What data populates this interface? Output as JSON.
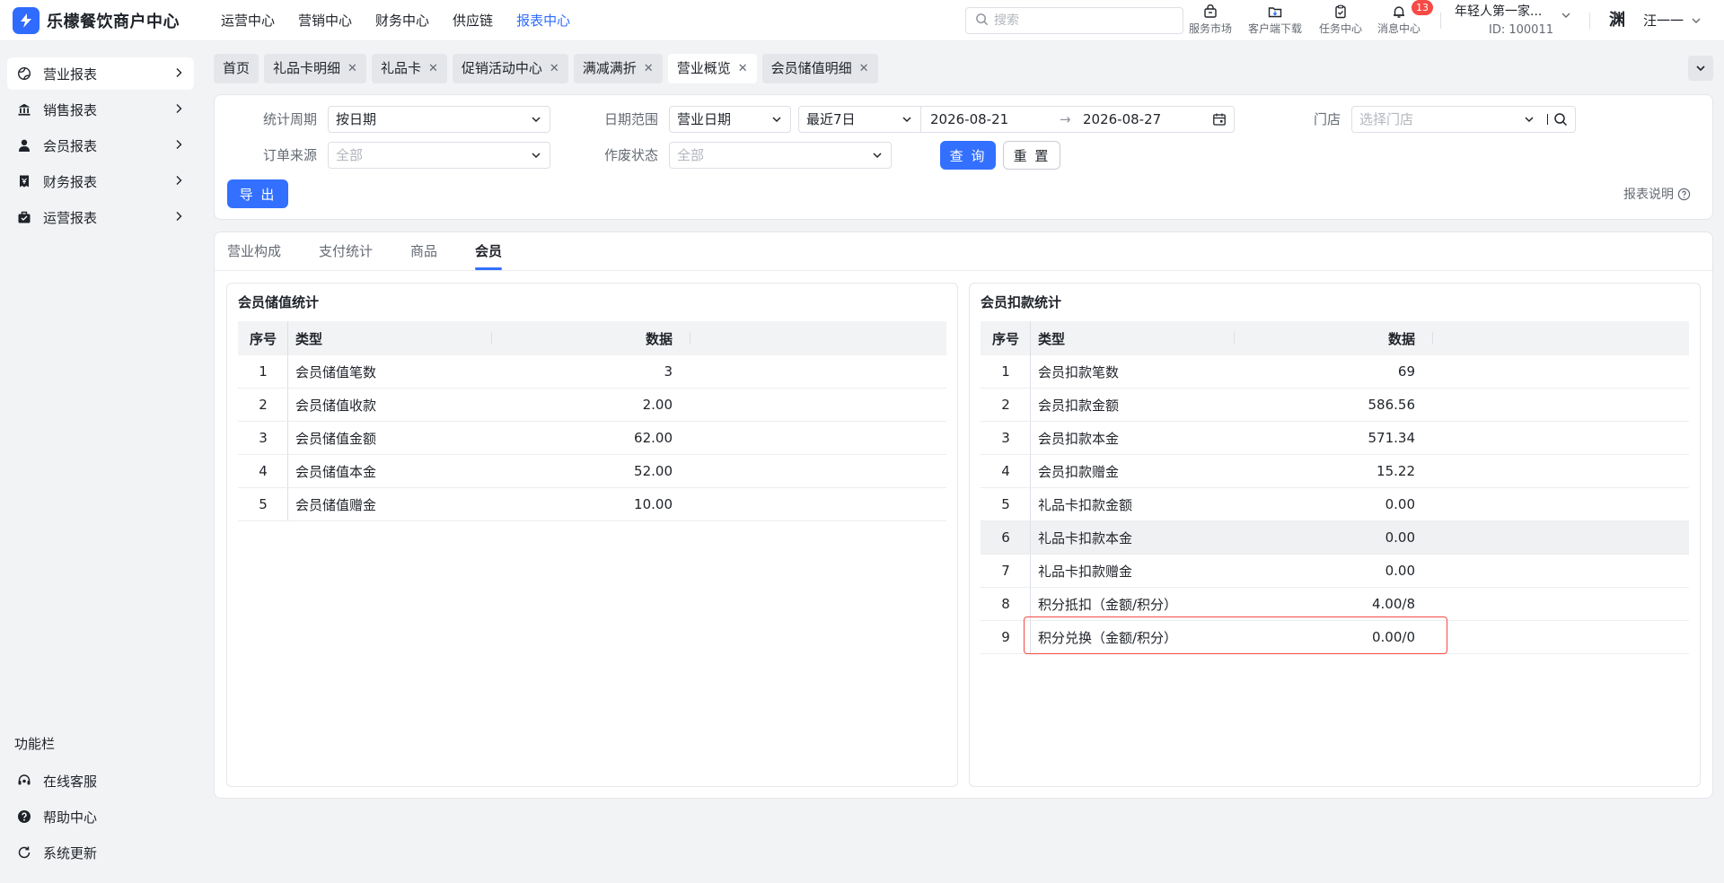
{
  "brand": {
    "name": "乐檬餐饮商户中心"
  },
  "topnav": [
    "运营中心",
    "营销中心",
    "财务中心",
    "供应链",
    "报表中心"
  ],
  "topnav_active": "报表中心",
  "search": {
    "placeholder": "搜索"
  },
  "tools": {
    "service_market": "服务市场",
    "client_download": "客户端下载",
    "task_center": "任务中心",
    "message_center": "消息中心",
    "message_badge": "13"
  },
  "tenant": {
    "name": "年轻人第一家...",
    "id": "ID: 100011"
  },
  "user": {
    "avatar_text": "渊",
    "name": "汪一一"
  },
  "sidebar": {
    "items": [
      {
        "label": "营业报表",
        "icon": "globe-icon"
      },
      {
        "label": "销售报表",
        "icon": "bank-icon"
      },
      {
        "label": "会员报表",
        "icon": "person-icon"
      },
      {
        "label": "财务报表",
        "icon": "receipt-icon"
      },
      {
        "label": "运营报表",
        "icon": "briefcase-icon"
      }
    ],
    "section_title": "功能栏",
    "utils": [
      {
        "label": "在线客服",
        "icon": "headset-icon"
      },
      {
        "label": "帮助中心",
        "icon": "help-icon"
      },
      {
        "label": "系统更新",
        "icon": "refresh-icon"
      }
    ]
  },
  "page_tabs": [
    {
      "label": "首页",
      "closable": false
    },
    {
      "label": "礼品卡明细",
      "closable": true
    },
    {
      "label": "礼品卡",
      "closable": true
    },
    {
      "label": "促销活动中心",
      "closable": true
    },
    {
      "label": "满减满折",
      "closable": true
    },
    {
      "label": "营业概览",
      "closable": true,
      "active": true
    },
    {
      "label": "会员储值明细",
      "closable": true
    }
  ],
  "filters": {
    "period_label": "统计周期",
    "period_value": "按日期",
    "date_range_label": "日期范围",
    "date_type_value": "营业日期",
    "date_preset_value": "最近7日",
    "date_start": "2026-08-21",
    "date_end": "2026-08-27",
    "date_sep": "→",
    "store_label": "门店",
    "store_placeholder": "选择门店",
    "order_source_label": "订单来源",
    "order_source_placeholder": "全部",
    "void_status_label": "作废状态",
    "void_status_placeholder": "全部",
    "query_button": "查 询",
    "reset_button": "重 置",
    "export_button": "导 出",
    "report_note": "报表说明"
  },
  "content_tabs": [
    "营业构成",
    "支付统计",
    "商品",
    "会员"
  ],
  "content_tab_active": "会员",
  "left_table": {
    "title": "会员储值统计",
    "headers": [
      "序号",
      "类型",
      "数据"
    ],
    "rows": [
      [
        "1",
        "会员储值笔数",
        "3"
      ],
      [
        "2",
        "会员储值收款",
        "2.00"
      ],
      [
        "3",
        "会员储值金额",
        "62.00"
      ],
      [
        "4",
        "会员储值本金",
        "52.00"
      ],
      [
        "5",
        "会员储值赠金",
        "10.00"
      ]
    ]
  },
  "right_table": {
    "title": "会员扣款统计",
    "headers": [
      "序号",
      "类型",
      "数据"
    ],
    "rows": [
      [
        "1",
        "会员扣款笔数",
        "69"
      ],
      [
        "2",
        "会员扣款金额",
        "586.56"
      ],
      [
        "3",
        "会员扣款本金",
        "571.34"
      ],
      [
        "4",
        "会员扣款赠金",
        "15.22"
      ],
      [
        "5",
        "礼品卡扣款金额",
        "0.00"
      ],
      [
        "6",
        "礼品卡扣款本金",
        "0.00"
      ],
      [
        "7",
        "礼品卡扣款赠金",
        "0.00"
      ],
      [
        "8",
        "积分抵扣（金额/积分）",
        "4.00/8"
      ],
      [
        "9",
        "积分兑换（金额/积分）",
        "0.00/0"
      ]
    ],
    "highlighted_row_index": 6,
    "boxed_row_index": 9
  },
  "colors": {
    "accent": "#3370ff",
    "annotation": "#f54a45",
    "page_bg": "#f2f3f5"
  }
}
